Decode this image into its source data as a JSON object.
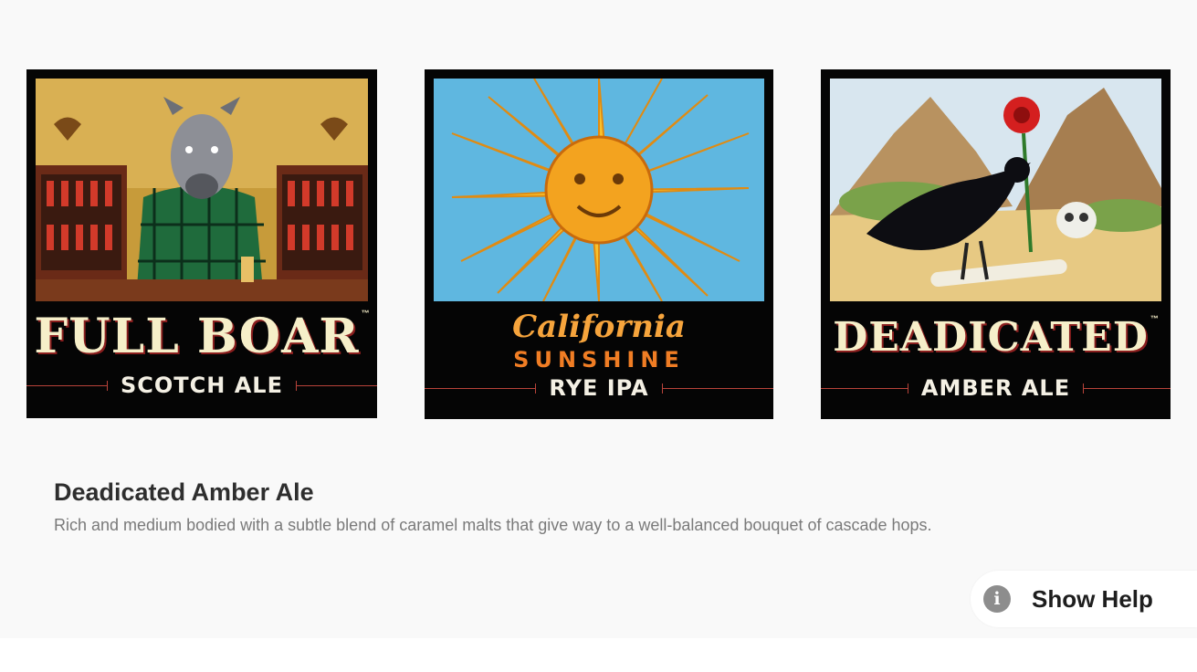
{
  "beers": [
    {
      "brand": "FULL BOAR",
      "tm": "™",
      "style": "SCOTCH ALE",
      "art_icon": "boar-bartender-illustration"
    },
    {
      "brand_script": "California",
      "brand_caps": "SUNSHINE",
      "style": "RYE IPA",
      "art_icon": "sun-face-illustration"
    },
    {
      "brand": "DEADICATED",
      "tm": "™",
      "style": "AMBER ALE",
      "art_icon": "raven-rose-skull-illustration"
    }
  ],
  "selected": {
    "title": "Deadicated Amber Ale",
    "description": "Rich and medium bodied with a subtle blend of caramel malts that give way to a well-balanced bouquet of cascade hops."
  },
  "help_button": {
    "label": "Show Help",
    "icon": "info-icon",
    "icon_glyph": "i"
  },
  "colors": {
    "background": "#f9f9f9",
    "card": "#050505",
    "cream": "#f6efc9",
    "accent_red": "#b9433a"
  }
}
